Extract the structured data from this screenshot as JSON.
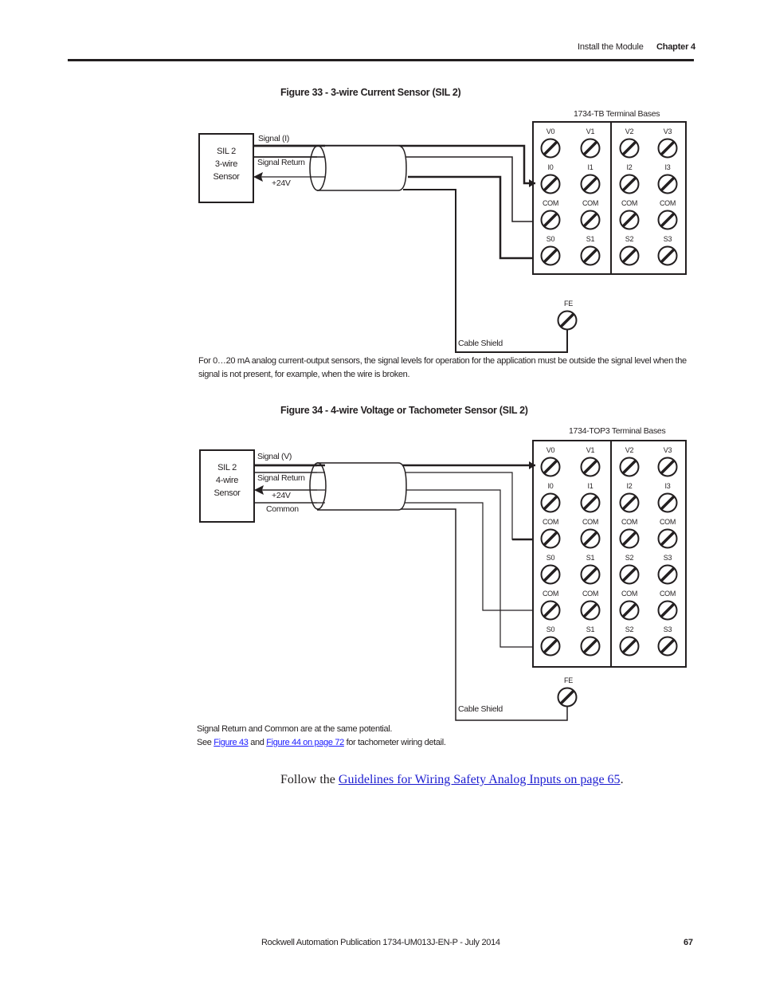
{
  "header": {
    "section": "Install the Module",
    "chapter": "Chapter 4"
  },
  "figure33": {
    "title": "Figure 33 - 3-wire Current Sensor (SIL 2)",
    "sensor_lines": [
      "SIL 2",
      "3-wire",
      "Sensor"
    ],
    "wires": [
      "Signal (I)",
      "Signal Return",
      "+24V"
    ],
    "terminal_base_title": "1734-TB Terminal Bases",
    "terminal_rows": [
      [
        "V0",
        "V1",
        "V2",
        "V3"
      ],
      [
        "I0",
        "I1",
        "I2",
        "I3"
      ],
      [
        "COM",
        "COM",
        "COM",
        "COM"
      ],
      [
        "S0",
        "S1",
        "S2",
        "S3"
      ]
    ],
    "fe_label": "FE",
    "cable_shield": "Cable Shield",
    "note": "For 0…20 mA analog current-output sensors, the signal levels for operation for the application must be outside the signal level when the signal is not present, for example, when the wire is broken."
  },
  "figure34": {
    "title": "Figure 34 - 4-wire Voltage or Tachometer Sensor (SIL 2)",
    "sensor_lines": [
      "SIL 2",
      "4-wire",
      "Sensor"
    ],
    "wires": [
      "Signal (V)",
      "Signal Return",
      "+24V",
      "Common"
    ],
    "terminal_base_title": "1734-TOP3 Terminal Bases",
    "terminal_rows": [
      [
        "V0",
        "V1",
        "V2",
        "V3"
      ],
      [
        "I0",
        "I1",
        "I2",
        "I3"
      ],
      [
        "COM",
        "COM",
        "COM",
        "COM"
      ],
      [
        "S0",
        "S1",
        "S2",
        "S3"
      ],
      [
        "COM",
        "COM",
        "COM",
        "COM"
      ],
      [
        "S0",
        "S1",
        "S2",
        "S3"
      ]
    ],
    "fe_label": "FE",
    "cable_shield": "Cable Shield",
    "note_line1": "Signal Return and Common are at the same potential.",
    "note_see": "See ",
    "note_link1": "Figure 43",
    "note_and": " and ",
    "note_link2": "Figure 44 on page 72",
    "note_tail": " for tachometer wiring detail."
  },
  "body": {
    "follow_prefix": "Follow the ",
    "follow_link": "Guidelines for Wiring Safety Analog Inputs on page 65",
    "follow_suffix": "."
  },
  "footer": {
    "publication": "Rockwell Automation Publication 1734-UM013J-EN-P - July 2014",
    "page_number": "67"
  }
}
